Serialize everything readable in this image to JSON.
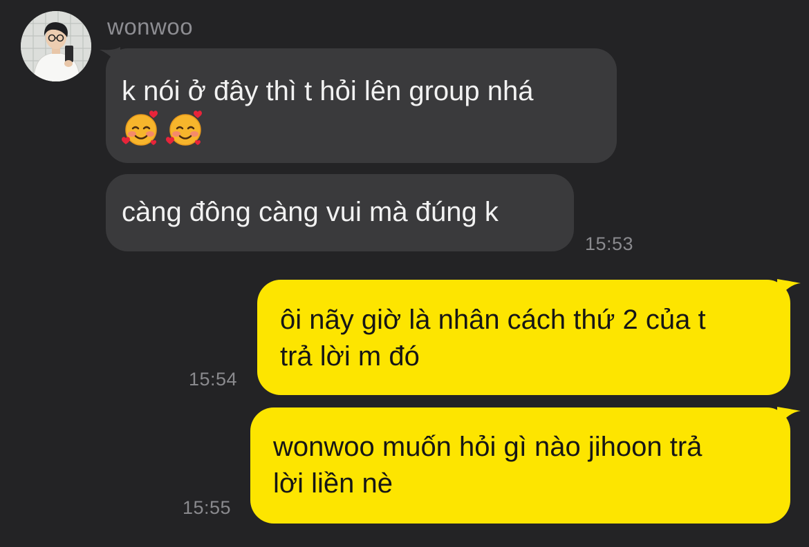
{
  "contact": {
    "name": "wonwoo",
    "avatar_icon": "contact-avatar-photo"
  },
  "colors": {
    "background": "#232325",
    "incoming_bubble": "#3a3a3c",
    "outgoing_bubble": "#fde500",
    "timestamp": "#8a8a8e"
  },
  "messages": [
    {
      "direction": "incoming",
      "text": "k nói ở đây thì t hỏi lên group nhá",
      "emojis": [
        "smiling-face-with-hearts-emoji",
        "smiling-face-with-hearts-emoji"
      ]
    },
    {
      "direction": "incoming",
      "text": "càng đông càng vui mà đúng k",
      "time": "15:53"
    },
    {
      "direction": "outgoing",
      "lines": [
        "ôi nãy giờ là nhân cách thứ 2 của t",
        "trả lời m đó"
      ],
      "time": "15:54"
    },
    {
      "direction": "outgoing",
      "lines": [
        "wonwoo muốn hỏi gì nào jihoon trả",
        "lời liền nè"
      ],
      "time": "15:55"
    }
  ]
}
